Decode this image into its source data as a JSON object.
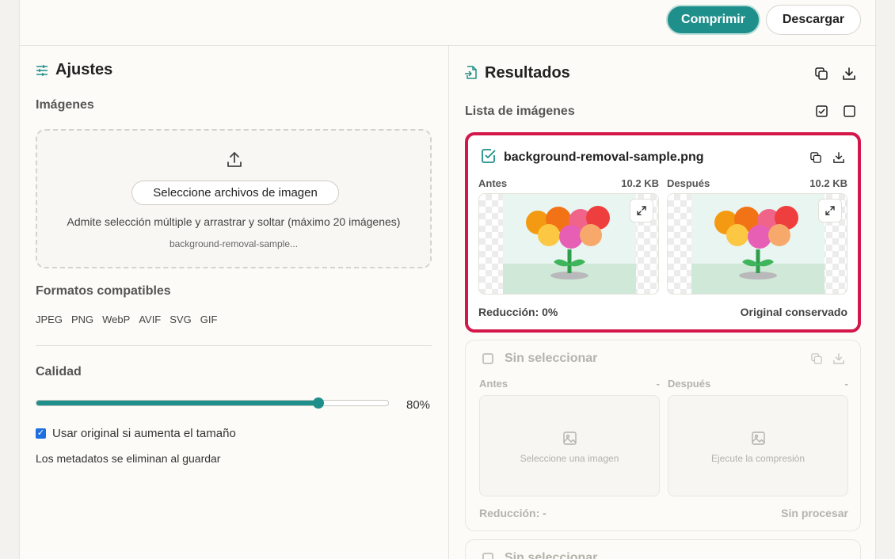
{
  "toolbar": {
    "compress_label": "Comprimir",
    "download_label": "Descargar"
  },
  "settings": {
    "title": "Ajustes",
    "images_label": "Imágenes",
    "select_button": "Seleccione archivos de imagen",
    "dropzone_hint": "Admite selección múltiple y arrastrar y soltar (máximo 20 imágenes)",
    "selected_file": "background-removal-sample...",
    "formats_label": "Formatos compatibles",
    "formats": [
      "JPEG",
      "PNG",
      "WebP",
      "AVIF",
      "SVG",
      "GIF"
    ],
    "quality_label": "Calidad",
    "quality_value": 80,
    "quality_text": "80%",
    "use_original_label": "Usar original si aumenta el tamaño",
    "use_original_checked": true,
    "metadata_note": "Los metadatos se eliminan al guardar"
  },
  "results": {
    "title": "Resultados",
    "list_label": "Lista de imágenes",
    "cards": [
      {
        "name": "background-removal-sample.png",
        "before_label": "Antes",
        "before_size": "10.2 KB",
        "after_label": "Después",
        "after_size": "10.2 KB",
        "reduction": "Reducción: 0%",
        "status": "Original conservado",
        "selected": true
      },
      {
        "name": "Sin seleccionar",
        "before_label": "Antes",
        "before_size": "-",
        "after_label": "Después",
        "after_size": "-",
        "before_placeholder": "Seleccione una imagen",
        "after_placeholder": "Ejecute la compresión",
        "reduction": "Reducción: -",
        "status": "Sin procesar",
        "selected": false
      },
      {
        "name": "Sin seleccionar"
      }
    ]
  },
  "colors": {
    "accent": "#1e8f8a",
    "highlight": "#d3174a",
    "checkbox": "#1f6fe0"
  }
}
